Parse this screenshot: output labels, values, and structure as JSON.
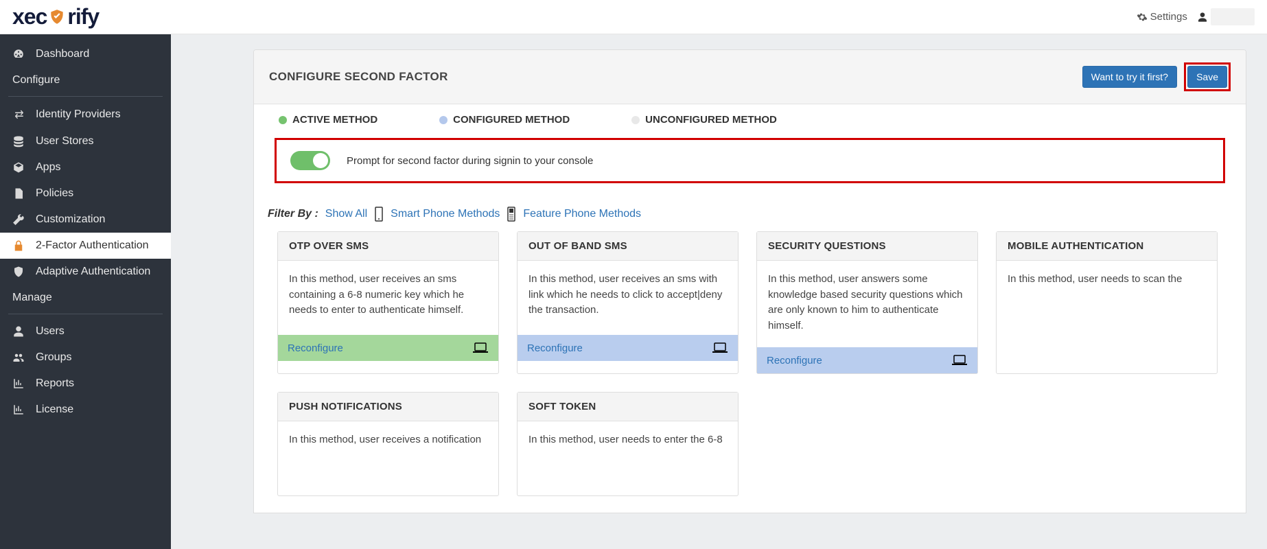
{
  "header": {
    "logo_pre": "xec",
    "logo_post": "rify",
    "settings": "Settings"
  },
  "sidebar": {
    "items": [
      {
        "label": "Dashboard",
        "icon": "dashboard"
      },
      {
        "section": "Configure"
      },
      {
        "label": "Identity Providers",
        "icon": "exchange"
      },
      {
        "label": "User Stores",
        "icon": "database"
      },
      {
        "label": "Apps",
        "icon": "cube"
      },
      {
        "label": "Policies",
        "icon": "file"
      },
      {
        "label": "Customization",
        "icon": "wrench"
      },
      {
        "label": "2-Factor Authentication",
        "icon": "lock",
        "active": true
      },
      {
        "label": "Adaptive Authentication",
        "icon": "shield"
      },
      {
        "section": "Manage"
      },
      {
        "label": "Users",
        "icon": "user"
      },
      {
        "label": "Groups",
        "icon": "group"
      },
      {
        "label": "Reports",
        "icon": "chart"
      },
      {
        "label": "License",
        "icon": "chart"
      }
    ]
  },
  "page": {
    "title": "CONFIGURE SECOND FACTOR",
    "try": "Want to try it first?",
    "save": "Save",
    "legend": {
      "active": "ACTIVE METHOD",
      "configured": "CONFIGURED METHOD",
      "unconfigured": "UNCONFIGURED METHOD"
    },
    "prompt": "Prompt for second factor during signin to your console",
    "filter": {
      "label": "Filter By :",
      "all": "Show All",
      "smart": "Smart Phone Methods",
      "feature": "Feature Phone Methods"
    },
    "cards": [
      {
        "t": "OTP OVER SMS",
        "d": "In this method, user receives an sms containing a 6-8 numeric key which he needs to enter to authenticate himself.",
        "foot": "Reconfigure",
        "cls": "foot-active"
      },
      {
        "t": "OUT OF BAND SMS",
        "d": "In this method, user receives an sms with link which he needs to click to accept|deny the transaction.",
        "foot": "Reconfigure",
        "cls": "foot-conf"
      },
      {
        "t": "SECURITY QUESTIONS",
        "d": "In this method, user answers some knowledge based security questions which are only known to him to authenticate himself.",
        "foot": "Reconfigure",
        "cls": "foot-conf"
      },
      {
        "t": "MOBILE AUTHENTICATION",
        "d": "In this method, user needs to scan the",
        "foot": "",
        "cls": ""
      },
      {
        "t": "PUSH NOTIFICATIONS",
        "d": "In this method, user receives a notification",
        "foot": "",
        "cls": ""
      },
      {
        "t": "SOFT TOKEN",
        "d": "In this method, user needs to enter the 6-8",
        "foot": "",
        "cls": ""
      }
    ]
  }
}
